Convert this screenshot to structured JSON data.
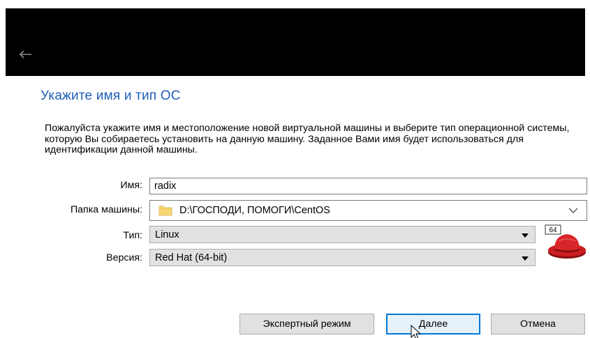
{
  "window": {
    "back_icon": "back-arrow-icon"
  },
  "page": {
    "heading": "Укажите имя и тип ОС",
    "description": "Пожалуйста укажите имя и местоположение новой виртуальной машины и выберите тип операционной системы, которую Вы собираетесь установить на данную машину. Заданное Вами имя будет использоваться для идентификации данной машины."
  },
  "form": {
    "name_label": "Имя:",
    "name_value": "radix",
    "folder_label": "Папка машины:",
    "folder_value": "D:\\ГОСПОДИ, ПОМОГИ\\CentOS",
    "type_label": "Тип:",
    "type_value": "Linux",
    "version_label": "Версия:",
    "version_value": "Red Hat (64-bit)",
    "os_icon": "redhat-64-icon",
    "os_badge": "64"
  },
  "buttons": {
    "expert": "Экспертный режим",
    "next_prefix": "",
    "next_underlined": "Д",
    "next_rest": "алее",
    "cancel": "Отмена"
  },
  "colors": {
    "heading": "#1f5fb5",
    "titlebar": "#000000",
    "default_button_border": "#0078d7",
    "folder_yellow": "#f8d775"
  }
}
